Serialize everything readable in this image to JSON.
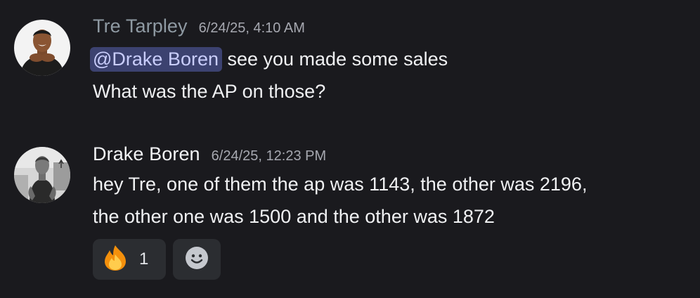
{
  "messages": [
    {
      "author": "Tre Tarpley",
      "timestamp": "6/24/25, 4:10 AM",
      "mention": "@Drake Boren",
      "lines": [
        " see you made some sales",
        "What was the AP on those?"
      ]
    },
    {
      "author": "Drake Boren",
      "timestamp": "6/24/25, 12:23 PM",
      "lines": [
        "hey Tre, one of them the ap was 1143, the other was 2196,",
        "the other one was 1500 and the other was 1872"
      ],
      "reactions": [
        {
          "emoji": "fire-icon",
          "count": "1"
        }
      ],
      "add_reaction_icon": "smiley-icon"
    }
  ],
  "colors": {
    "background": "#1a1a1e",
    "mention_bg": "#3c4270",
    "mention_text": "#c9cdfb",
    "reaction_bg": "#2b2d31"
  }
}
